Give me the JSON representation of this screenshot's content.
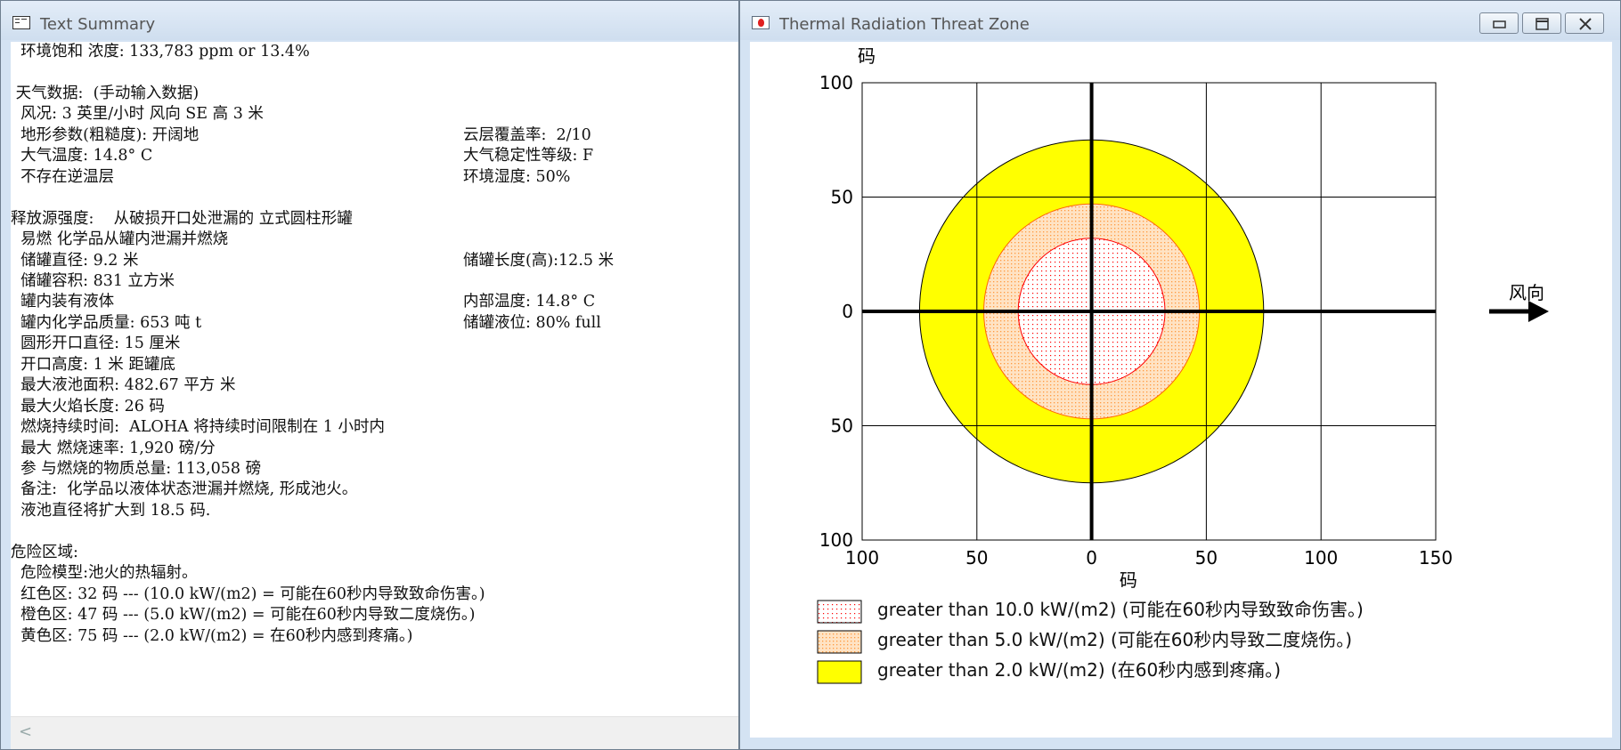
{
  "text_window": {
    "title": "Text Summary",
    "lines": [
      "  环境饱和 浓度: 133,783 ppm or 13.4%",
      "",
      " 天气数据:  (手动输入数据)",
      "  风况: 3 英里/小时 风向 SE 高 3 米",
      "  地形参数(粗糙度): 开阔地",
      "  大气温度: 14.8° C",
      "  不存在逆温层",
      "",
      "释放源强度:    从破损开口处泄漏的 立式圆柱形罐",
      "  易燃 化学品从罐内泄漏并燃烧",
      "  储罐直径: 9.2 米",
      "  储罐容积: 831 立方米",
      "  罐内装有液体",
      "  罐内化学品质量: 653 吨 t",
      "  圆形开口直径: 15 厘米",
      "  开口高度: 1 米 距罐底",
      "  最大液池面积: 482.67 平方 米",
      "  最大火焰长度: 26 码",
      "  燃烧持续时间:  ALOHA 将持续时间限制在 1 小时内",
      "  最大 燃烧速率: 1,920 磅/分",
      "  参 与燃烧的物质总量: 113,058 磅",
      "  备注:  化学品以液体状态泄漏并燃烧, 形成池火。",
      "  液池直径将扩大到 18.5 码.",
      "",
      "危险区域:",
      "  危险模型:池火的热辐射。",
      "  红色区: 32 码 --- (10.0 kW/(m2) = 可能在60秒内导致致命伤害。)",
      "  橙色区: 47 码 --- (5.0 kW/(m2) = 可能在60秒内导致二度烧伤。)",
      "  黄色区: 75 码 --- (2.0 kW/(m2) = 在60秒内感到疼痛。)"
    ],
    "right_column": [
      {
        "row": 4,
        "text": "云层覆盖率:  2/10"
      },
      {
        "row": 5,
        "text": "大气稳定性等级: F"
      },
      {
        "row": 6,
        "text": "环境湿度: 50%"
      },
      {
        "row": 10,
        "text": "储罐长度(高):12.5 米"
      },
      {
        "row": 12,
        "text": "内部温度: 14.8° C"
      },
      {
        "row": 13,
        "text": "储罐液位: 80% full"
      }
    ],
    "scroll_arrow": "<"
  },
  "chart_window": {
    "title": "Thermal Radiation Threat Zone",
    "controls": [
      "minimize-icon",
      "restore-icon",
      "close-icon"
    ],
    "wind_label": "风向"
  },
  "chart_data": {
    "type": "threat-zone",
    "x_label": "码",
    "y_label": "码",
    "xlim": [
      -100,
      150
    ],
    "ylim": [
      -100,
      100
    ],
    "x_ticks": [
      {
        "value": -100,
        "label": "100"
      },
      {
        "value": -50,
        "label": "50"
      },
      {
        "value": 0,
        "label": "0"
      },
      {
        "value": 50,
        "label": "50"
      },
      {
        "value": 100,
        "label": "100"
      },
      {
        "value": 150,
        "label": "150"
      }
    ],
    "y_ticks": [
      {
        "value": 100,
        "label": "100"
      },
      {
        "value": 50,
        "label": "50"
      },
      {
        "value": 0,
        "label": "0"
      },
      {
        "value": -50,
        "label": "50"
      },
      {
        "value": -100,
        "label": "100"
      }
    ],
    "grid": true,
    "legend_position": "bottom",
    "zones": [
      {
        "name": "yellow",
        "radius": 75,
        "fill": "#ffff00",
        "stroke": "#000000",
        "pattern": "solid",
        "legend": "greater than 2.0 kW/(m2) (在60秒内感到疼痛。)"
      },
      {
        "name": "orange",
        "radius": 47,
        "fill": "#ffc080",
        "stroke": "#ff6600",
        "pattern": "dots",
        "legend": "greater than 5.0 kW/(m2) (可能在60秒内导致二度烧伤。)"
      },
      {
        "name": "red",
        "radius": 32,
        "fill": "#ff0000",
        "stroke": "#ff0000",
        "pattern": "dots",
        "legend": "greater than 10.0 kW/(m2) (可能在60秒内导致致命伤害。)"
      }
    ]
  }
}
